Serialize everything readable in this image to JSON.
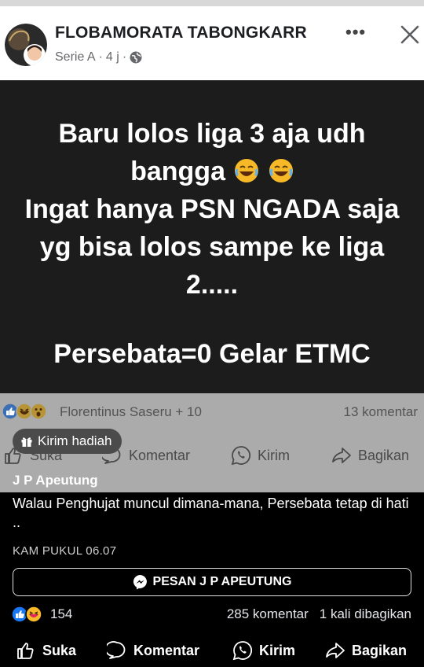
{
  "post": {
    "group_name": "FLOBAMORATA TABONGKARR",
    "meta_source": "Serie A",
    "meta_sep1": "·",
    "meta_time": "4 j",
    "meta_sep2": "·",
    "more_label": "•••",
    "image_text": {
      "line1": "Baru lolos liga 3 aja udh",
      "line2": "bangga",
      "line3": "Ingat hanya PSN NGADA saja",
      "line4": "yg bisa lolos sampe ke liga",
      "line5": "2.....",
      "line6": "Persebata=0 Gelar ETMC"
    },
    "reaction_names": "Florentinus Saseru + 10",
    "comment_count": "13 komentar",
    "actions": {
      "like": "Suka",
      "comment": "Komentar",
      "send": "Kirim",
      "share": "Bagikan"
    }
  },
  "gift_button": "Kirim hadiah",
  "sheet": {
    "author": "J P Apeutung",
    "caption": "Walau Penghujat muncul dimana-mana, Persebata tetap di hati ..",
    "timestamp": "KAM PUKUL 06.07",
    "message_button": "PESAN J P APEUTUNG",
    "reaction_count": "154",
    "comments": "285 komentar",
    "shares": "1 kali dibagikan",
    "actions": {
      "like": "Suka",
      "comment": "Komentar",
      "send": "Kirim",
      "share": "Bagikan"
    }
  },
  "colors": {
    "like_blue": "#1877f2",
    "haha_yellow": "#f7b928",
    "sheet_bg": "#000000",
    "post_bg": "#1c1c1c"
  },
  "icons": [
    "globe-icon",
    "close-icon",
    "like-icon",
    "haha-icon",
    "wow-icon",
    "comment-icon",
    "whatsapp-icon",
    "share-icon",
    "gift-icon",
    "messenger-icon",
    "laughing-crying-emoji"
  ]
}
